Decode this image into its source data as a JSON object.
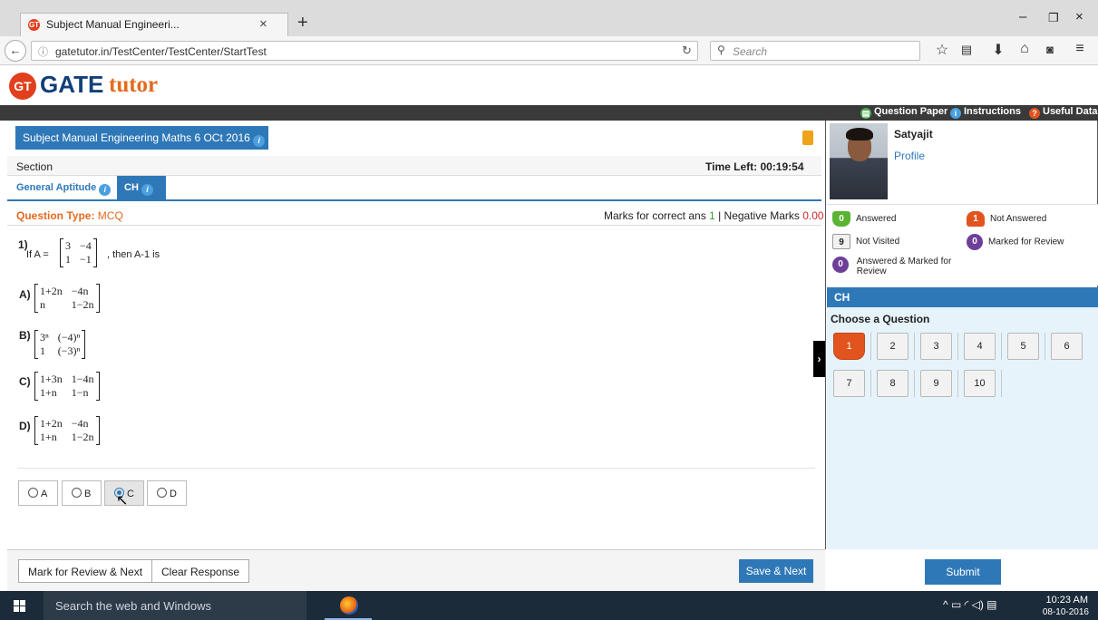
{
  "browser": {
    "tab_title": "Subject Manual Engineeri...",
    "tab_close": "×",
    "new_tab": "+",
    "window_min": "–",
    "window_restore": "❐",
    "window_close": "×",
    "back": "←",
    "info": "ⓘ",
    "url": "gatetutor.in/TestCenter/TestCenter/StartTest",
    "reload": "↻",
    "search_icon": "⚲",
    "search_placeholder": "Search",
    "toolbar_icons": [
      "star-icon",
      "reading-list-icon",
      "download-icon",
      "home-icon",
      "pocket-icon",
      "menu-icon"
    ]
  },
  "site": {
    "logo_badge": "GT",
    "logo_gate": "GATE",
    "logo_tutor": "tutor",
    "top_links": {
      "question_paper": "Question Paper",
      "instructions": "Instructions",
      "useful_data": "Useful Data"
    }
  },
  "test": {
    "title": "Subject Manual Engineering Maths 6 OCt 2016",
    "info_glyph": "i",
    "section_label": "Section",
    "time_left": "Time Left: 00:19:54",
    "tabs": [
      {
        "label": "General Aptitude"
      },
      {
        "label": "CH"
      }
    ],
    "question_type_label": "Question Type:",
    "question_type_value": "MCQ",
    "marks_prefix": "Marks for correct ans",
    "marks_correct": "1",
    "marks_mid": "| Negative Marks",
    "marks_negative": "0.00"
  },
  "question": {
    "number": "1)",
    "prefix": "If A =",
    "matrix_a": [
      "3",
      "−4",
      "1",
      "−1"
    ],
    "suffix": ", then A-1  is",
    "options": [
      {
        "label": "A)",
        "cells": [
          "1+2n",
          "−4n",
          "n",
          "1−2n"
        ]
      },
      {
        "label": "B)",
        "cells": [
          "3ⁿ",
          "(−4)ⁿ",
          "1",
          "(−3)ⁿ"
        ]
      },
      {
        "label": "C)",
        "cells": [
          "1+3n",
          "1−4n",
          "1+n",
          "1−n"
        ]
      },
      {
        "label": "D)",
        "cells": [
          "1+2n",
          "−4n",
          "1+n",
          "1−2n"
        ]
      }
    ],
    "answers": [
      {
        "label": "A",
        "selected": false
      },
      {
        "label": "B",
        "selected": false
      },
      {
        "label": "C",
        "selected": true
      },
      {
        "label": "D",
        "selected": false
      }
    ]
  },
  "buttons": {
    "mark_review": "Mark for Review & Next",
    "clear": "Clear Response",
    "save_next": "Save & Next",
    "submit": "Submit",
    "expand": "›"
  },
  "candidate": {
    "name": "Satyajit",
    "profile": "Profile"
  },
  "legend": {
    "answered_count": "0",
    "answered_label": "Answered",
    "not_answered_count": "1",
    "not_answered_label": "Not Answered",
    "not_visited_count": "9",
    "not_visited_label": "Not Visited",
    "marked_count": "0",
    "marked_label": "Marked for Review",
    "answered_marked_count": "0",
    "answered_marked_label": "Answered & Marked for",
    "answered_marked_label2": "Review"
  },
  "palette": {
    "section": "CH",
    "choose_label": "Choose a Question",
    "questions": [
      "1",
      "2",
      "3",
      "4",
      "5",
      "6",
      "7",
      "8",
      "9",
      "10"
    ],
    "current": "1"
  },
  "taskbar": {
    "search_text": "Search the web and Windows",
    "tray": "^  ▭  ◜  ◁)  ▤",
    "time": "10:23 AM",
    "date": "08-10-2016"
  },
  "colors": {
    "accent": "#2f78b8",
    "brand_orange": "#e46a1e",
    "brand_navy": "#123f7a",
    "answered": "#5ab434",
    "not_answered": "#e2541e",
    "marked": "#6d3f98"
  }
}
